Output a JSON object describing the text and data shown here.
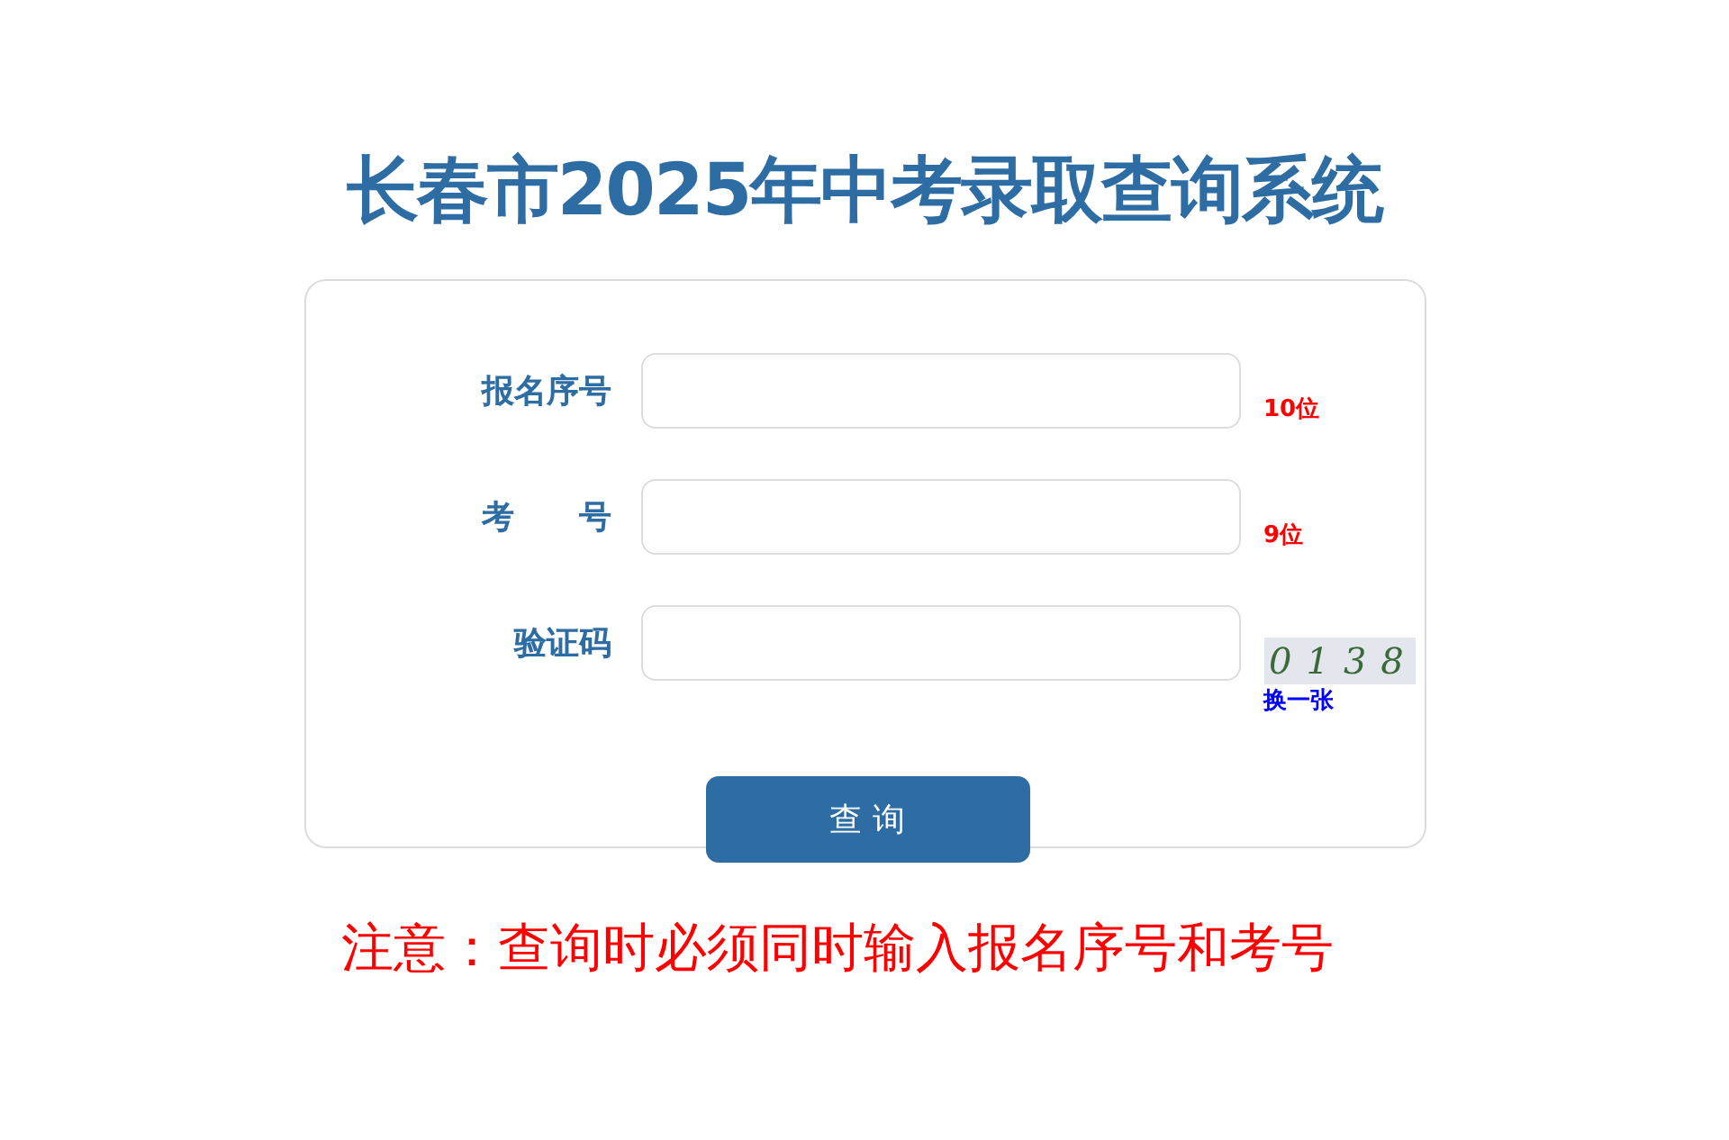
{
  "title": "长春市2025年中考录取查询系统",
  "fields": [
    {
      "label": "报名序号",
      "kind": "text",
      "hint": "10位"
    },
    {
      "label": "考　　号",
      "kind": "text",
      "hint": "9位"
    },
    {
      "label": "验证码",
      "kind": "captcha",
      "captcha": "0138",
      "refresh": "换一张"
    }
  ],
  "submit": "查 询",
  "notice": "注意：查询时必须同时输入报名序号和考号"
}
